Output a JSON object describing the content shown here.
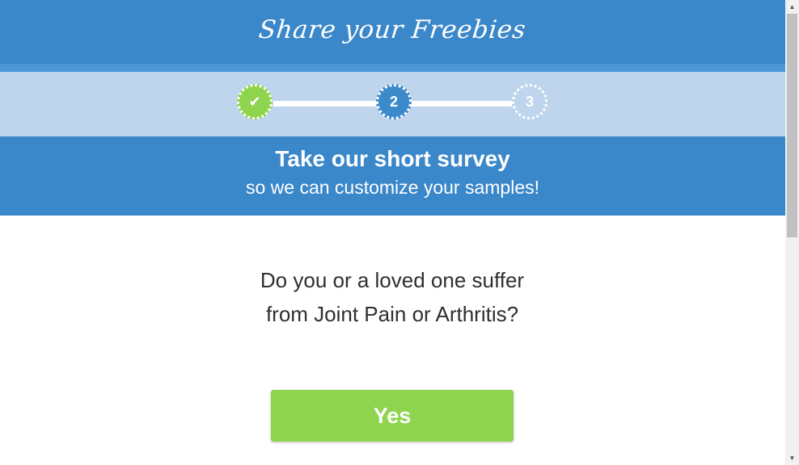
{
  "header": {
    "logo_text": "Share your Freebies"
  },
  "steps": [
    {
      "label": "✔",
      "state": "completed"
    },
    {
      "label": "2",
      "state": "current"
    },
    {
      "label": "3",
      "state": "upcoming"
    }
  ],
  "banner": {
    "title": "Take our short survey",
    "subtitle": "so we can customize your samples!"
  },
  "survey": {
    "question": "Do you or a loved one suffer from Joint Pain or Arthritis?",
    "yes_label": "Yes"
  },
  "colors": {
    "primary_blue": "#3a87c9",
    "light_blue": "#bed5ed",
    "accent_green": "#8ed44e",
    "text_dark": "#2f2f2f"
  },
  "scrollbar": {
    "up_icon": "▲",
    "down_icon": "▼"
  }
}
